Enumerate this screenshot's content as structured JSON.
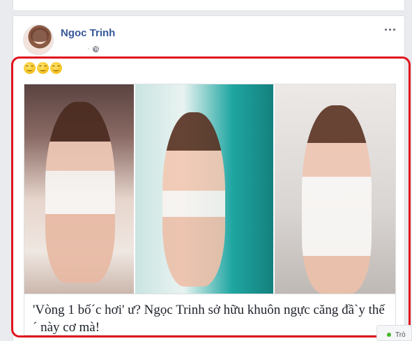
{
  "post": {
    "author": "Ngoc Trinh",
    "meta_separator": "·",
    "reactions_text": "😊😊😊",
    "link_preview": {
      "title": "'Vòng 1 bố´c hơi' ư? Ngọc Trinh sở hữu khuôn ngực căng đầ`y thế´ này cơ mà!"
    }
  },
  "corner_chip": {
    "label": "Trò"
  },
  "colors": {
    "author": "#365899",
    "highlight": "#e0141d",
    "background": "#e9ebee"
  }
}
